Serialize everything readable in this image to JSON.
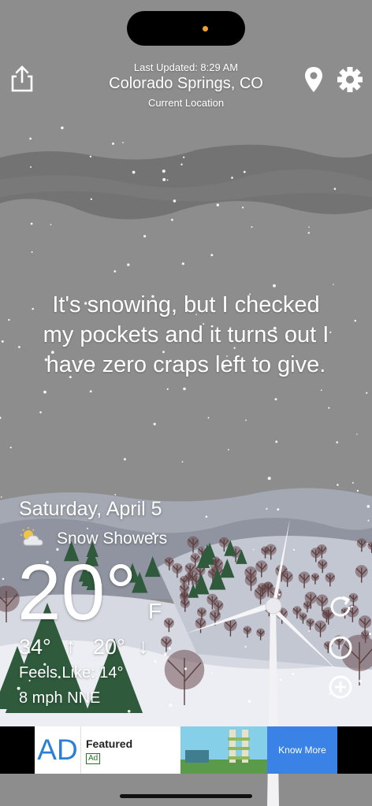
{
  "header": {
    "last_updated": "Last Updated: 8:29 AM",
    "location": "Colorado Springs, CO",
    "location_sub": "Current Location"
  },
  "icons": {
    "share": "share-icon",
    "location": "location-pin-icon",
    "settings": "gear-icon",
    "refresh": "refresh-icon",
    "radar": "circle-icon",
    "add": "plus-icon",
    "condition": "partly-cloudy-snow-icon"
  },
  "quote": {
    "lines": [
      "It's snowing, but I checked",
      "my pockets and it turns out I",
      "have zero craps left to give."
    ]
  },
  "weather": {
    "date": "Saturday, April 5",
    "condition": "Snow Showers",
    "temp": "20°",
    "unit": "F",
    "high": "34°",
    "low": "20°",
    "feels_like": "Feels Like: 14°",
    "wind": "8 mph NNE"
  },
  "ad": {
    "logo": "AD",
    "title": "Featured",
    "badge": "Ad",
    "button": "Know More"
  },
  "colors": {
    "sky": "#8d8d8d",
    "cloud": "#6f6f6f",
    "mountain": "#9aa0aa",
    "snow_ground": "#e6e8ee",
    "tree_green": "#2f5a3c",
    "ad_button": "#3b82e6"
  }
}
